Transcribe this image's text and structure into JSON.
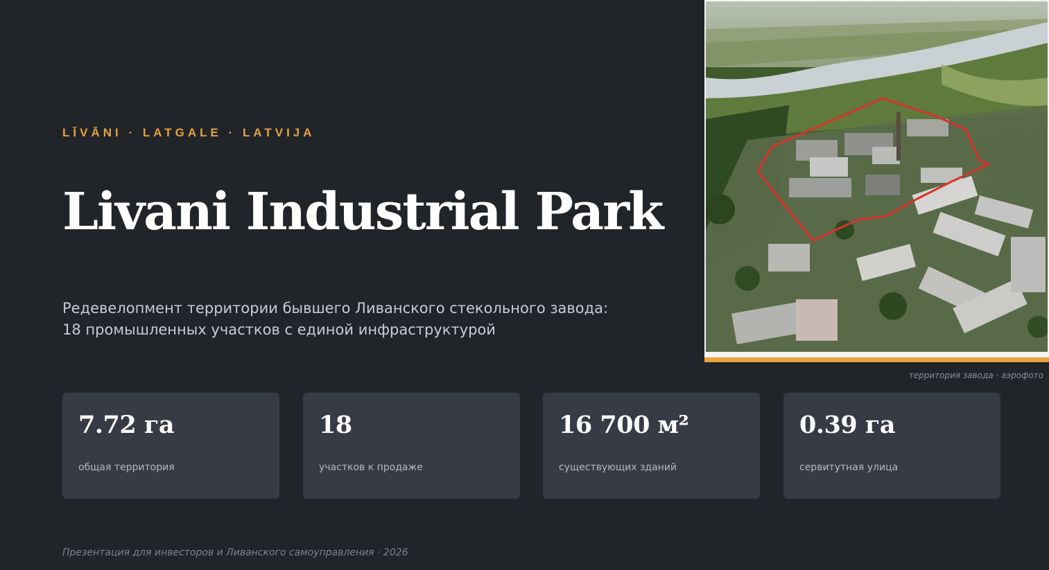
{
  "eyebrow": "LĪVĀNI · LATGALE · LATVIJA",
  "title": "Livani Industrial Park",
  "subtitle": {
    "line1": "Редевелопмент территории бывшего Ливанского стекольного завода:",
    "line2": "18 промышленных участков с единой инфраструктурой"
  },
  "photo_caption": "территория завода · аэрофото",
  "stats": [
    {
      "value": "7.72 га",
      "label": "общая территория"
    },
    {
      "value": "18",
      "label": "участков к продаже"
    },
    {
      "value": "16 700 м²",
      "label": "существующих зданий"
    },
    {
      "value": "0.39 га",
      "label": "сервитутная улица"
    }
  ],
  "footer": "Презентация для инвесторов и Ливанского самоуправления · 2026",
  "colors": {
    "background": "#212429",
    "card": "#373b45",
    "accent": "#e8a33d",
    "site_outline": "#d9322b"
  }
}
